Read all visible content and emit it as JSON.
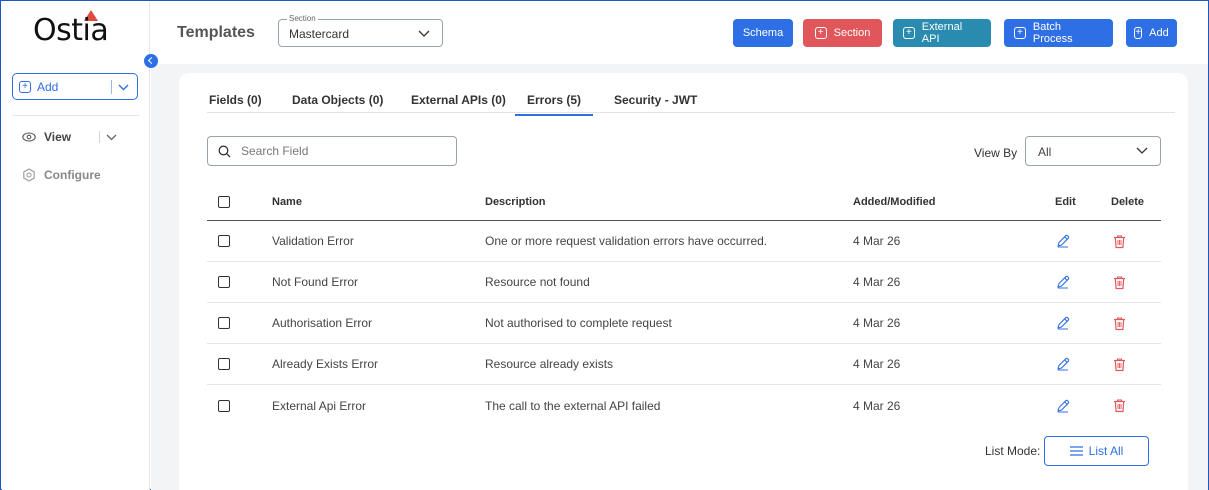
{
  "app": {
    "logo_text": "Ostia"
  },
  "sidebar": {
    "add_label": "Add",
    "items": [
      {
        "label": "View",
        "icon": "eye-icon"
      },
      {
        "label": "Configure",
        "icon": "gear-icon"
      }
    ]
  },
  "header": {
    "title": "Templates",
    "section_legend": "Section",
    "section_value": "Mastercard",
    "buttons": {
      "schema": "Schema",
      "section": "Section",
      "external_api": "External API",
      "batch_process": "Batch Process",
      "add": "Add"
    }
  },
  "tabs": [
    {
      "label": "Fields (0)",
      "active": false
    },
    {
      "label": "Data Objects (0)",
      "active": false
    },
    {
      "label": "External APIs (0)",
      "active": false
    },
    {
      "label": "Errors (5)",
      "active": true
    },
    {
      "label": "Security - JWT",
      "active": false
    }
  ],
  "search": {
    "placeholder": "Search Field",
    "value": ""
  },
  "view_by": {
    "label": "View By",
    "value": "All"
  },
  "table": {
    "headers": {
      "name": "Name",
      "description": "Description",
      "added_modified": "Added/Modified",
      "edit": "Edit",
      "delete": "Delete"
    },
    "rows": [
      {
        "name": "Validation Error",
        "description": "One or more request validation errors have occurred.",
        "date": "4 Mar 26"
      },
      {
        "name": "Not Found Error",
        "description": "Resource not found",
        "date": "4 Mar 26"
      },
      {
        "name": "Authorisation Error",
        "description": "Not authorised to complete request",
        "date": "4 Mar 26"
      },
      {
        "name": "Already Exists Error",
        "description": "Resource already exists",
        "date": "4 Mar 26"
      },
      {
        "name": "External Api Error",
        "description": "The call to the external API failed",
        "date": "4 Mar 26"
      }
    ]
  },
  "footer": {
    "list_mode_label": "List Mode:",
    "list_all_label": "List All"
  },
  "colors": {
    "primary": "#2f6fe6",
    "danger": "#e0565b",
    "teal": "#2a8bb0",
    "logo_accent": "#e04a3f"
  }
}
